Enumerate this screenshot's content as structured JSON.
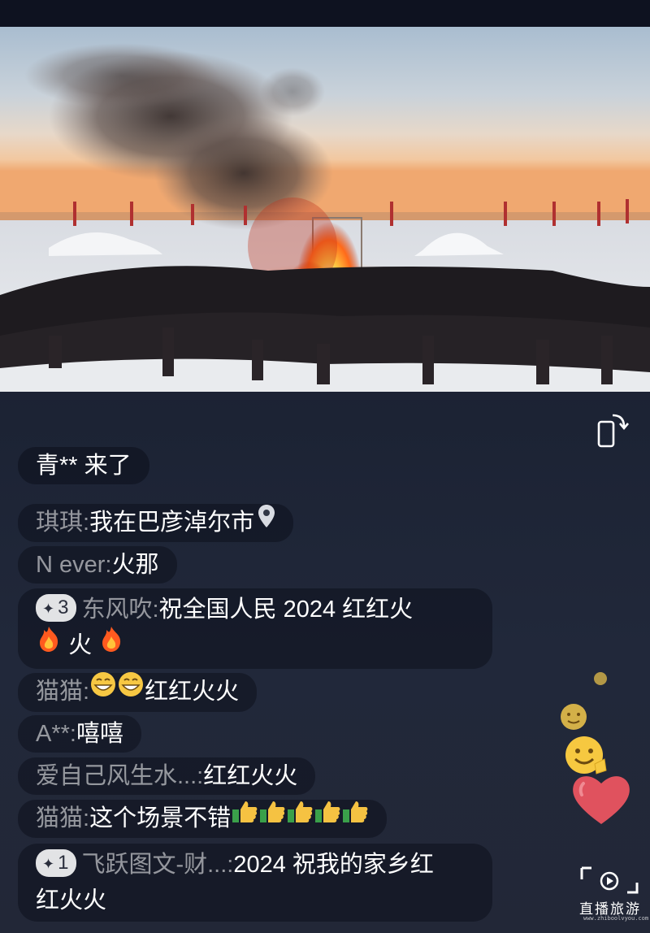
{
  "chat": {
    "join_notice": "青** 来了",
    "messages": [
      {
        "user": "琪琪",
        "text": "我在巴彦淖尔市",
        "location_icon": "location-pin-icon"
      },
      {
        "user": "N ever",
        "text": "火那"
      },
      {
        "badge": "3",
        "user": "东风吹",
        "text": "祝全国人民 2024 红红火",
        "text2": "火"
      },
      {
        "user": "猫猫",
        "text": "红红火火"
      },
      {
        "user": "A**",
        "text": "嘻嘻"
      },
      {
        "user": "爱自己风生水...",
        "text": "红红火火"
      },
      {
        "user": "猫猫",
        "text": "这个场景不错"
      },
      {
        "badge": "1",
        "user": "飞跃图文-财...",
        "text": "2024 祝我的家乡红",
        "text2": "红火火"
      }
    ],
    "separator": ":"
  },
  "video": {
    "scene": "bonfire-snow-festival"
  },
  "watermark": {
    "brand": "直播旅游",
    "url": "www.zhiboolvyou.com"
  },
  "colors": {
    "background": "#1b2233",
    "heart": "#e0525e",
    "badge_bg": "#e6e6ea"
  }
}
